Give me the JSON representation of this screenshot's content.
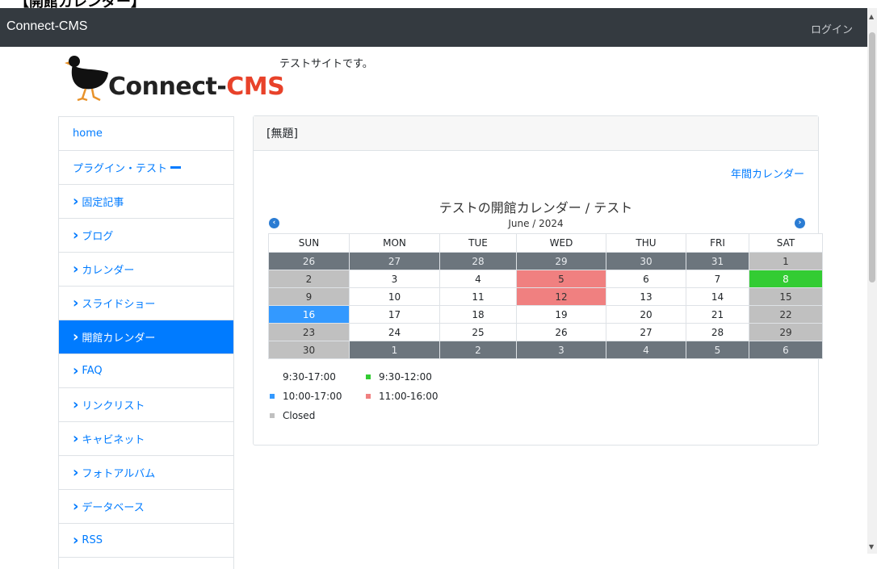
{
  "header": {
    "caption": "【開館カレンダー】",
    "brand": "Connect-CMS",
    "login": "ログイン"
  },
  "logo": {
    "part1": "Connect-",
    "part2": "CMS",
    "brand_color": "#e8422a"
  },
  "site_description": "テストサイトです。",
  "sidebar": {
    "items": [
      {
        "label": "home",
        "prefix": "",
        "active": false
      },
      {
        "label": "プラグイン・テスト",
        "prefix": "",
        "active": false,
        "expanded": true
      },
      {
        "label": "固定記事",
        "prefix": "chevron-right",
        "active": false
      },
      {
        "label": "ブログ",
        "prefix": "chevron-right",
        "active": false
      },
      {
        "label": "カレンダー",
        "prefix": "chevron-right",
        "active": false
      },
      {
        "label": "スライドショー",
        "prefix": "chevron-right",
        "active": false
      },
      {
        "label": "開館カレンダー",
        "prefix": "chevron-right",
        "active": true
      },
      {
        "label": "FAQ",
        "prefix": "chevron-right",
        "active": false
      },
      {
        "label": "リンクリスト",
        "prefix": "chevron-right",
        "active": false
      },
      {
        "label": "キャビネット",
        "prefix": "chevron-right",
        "active": false
      },
      {
        "label": "フォトアルバム",
        "prefix": "chevron-right",
        "active": false
      },
      {
        "label": "データベース",
        "prefix": "chevron-right",
        "active": false
      },
      {
        "label": "RSS",
        "prefix": "chevron-right",
        "active": false
      }
    ]
  },
  "card": {
    "header": "[無題]",
    "annual_link": "年間カレンダー",
    "calendar_title": "テストの開館カレンダー / テスト",
    "month_label": "June / 2024",
    "weekdays": [
      "SUN",
      "MON",
      "TUE",
      "WED",
      "THU",
      "FRI",
      "SAT"
    ],
    "weeks": [
      [
        {
          "d": "26",
          "s": "other"
        },
        {
          "d": "27",
          "s": "other"
        },
        {
          "d": "28",
          "s": "other"
        },
        {
          "d": "29",
          "s": "other"
        },
        {
          "d": "30",
          "s": "other"
        },
        {
          "d": "31",
          "s": "other"
        },
        {
          "d": "1",
          "s": "closed"
        }
      ],
      [
        {
          "d": "2",
          "s": "closed"
        },
        {
          "d": "3",
          "s": ""
        },
        {
          "d": "4",
          "s": ""
        },
        {
          "d": "5",
          "s": "pink"
        },
        {
          "d": "6",
          "s": ""
        },
        {
          "d": "7",
          "s": ""
        },
        {
          "d": "8",
          "s": "green"
        }
      ],
      [
        {
          "d": "9",
          "s": "closed"
        },
        {
          "d": "10",
          "s": ""
        },
        {
          "d": "11",
          "s": ""
        },
        {
          "d": "12",
          "s": "pink"
        },
        {
          "d": "13",
          "s": ""
        },
        {
          "d": "14",
          "s": ""
        },
        {
          "d": "15",
          "s": "closed"
        }
      ],
      [
        {
          "d": "16",
          "s": "blue"
        },
        {
          "d": "17",
          "s": ""
        },
        {
          "d": "18",
          "s": ""
        },
        {
          "d": "19",
          "s": ""
        },
        {
          "d": "20",
          "s": ""
        },
        {
          "d": "21",
          "s": ""
        },
        {
          "d": "22",
          "s": "closed"
        }
      ],
      [
        {
          "d": "23",
          "s": "closed"
        },
        {
          "d": "24",
          "s": ""
        },
        {
          "d": "25",
          "s": ""
        },
        {
          "d": "26",
          "s": ""
        },
        {
          "d": "27",
          "s": ""
        },
        {
          "d": "28",
          "s": ""
        },
        {
          "d": "29",
          "s": "closed"
        }
      ],
      [
        {
          "d": "30",
          "s": "closed"
        },
        {
          "d": "1",
          "s": "other"
        },
        {
          "d": "2",
          "s": "other"
        },
        {
          "d": "3",
          "s": "other"
        },
        {
          "d": "4",
          "s": "other"
        },
        {
          "d": "5",
          "s": "other"
        },
        {
          "d": "6",
          "s": "other"
        }
      ]
    ],
    "legend": [
      {
        "label": "9:30-17:00",
        "color": "#ffffff"
      },
      {
        "label": "9:30-12:00",
        "color": "#33cc33"
      },
      {
        "label": "10:00-17:00",
        "color": "#3399ff"
      },
      {
        "label": "11:00-16:00",
        "color": "#f08080"
      },
      {
        "label": "Closed",
        "color": "#c0c0c0"
      }
    ]
  },
  "colors": {
    "navbar": "#343a40",
    "link": "#007bff",
    "active": "#007bff",
    "other_month": "#6c757d",
    "closed": "#c0c0c0",
    "green": "#33cc33",
    "blue": "#3399ff",
    "pink": "#f08080"
  }
}
